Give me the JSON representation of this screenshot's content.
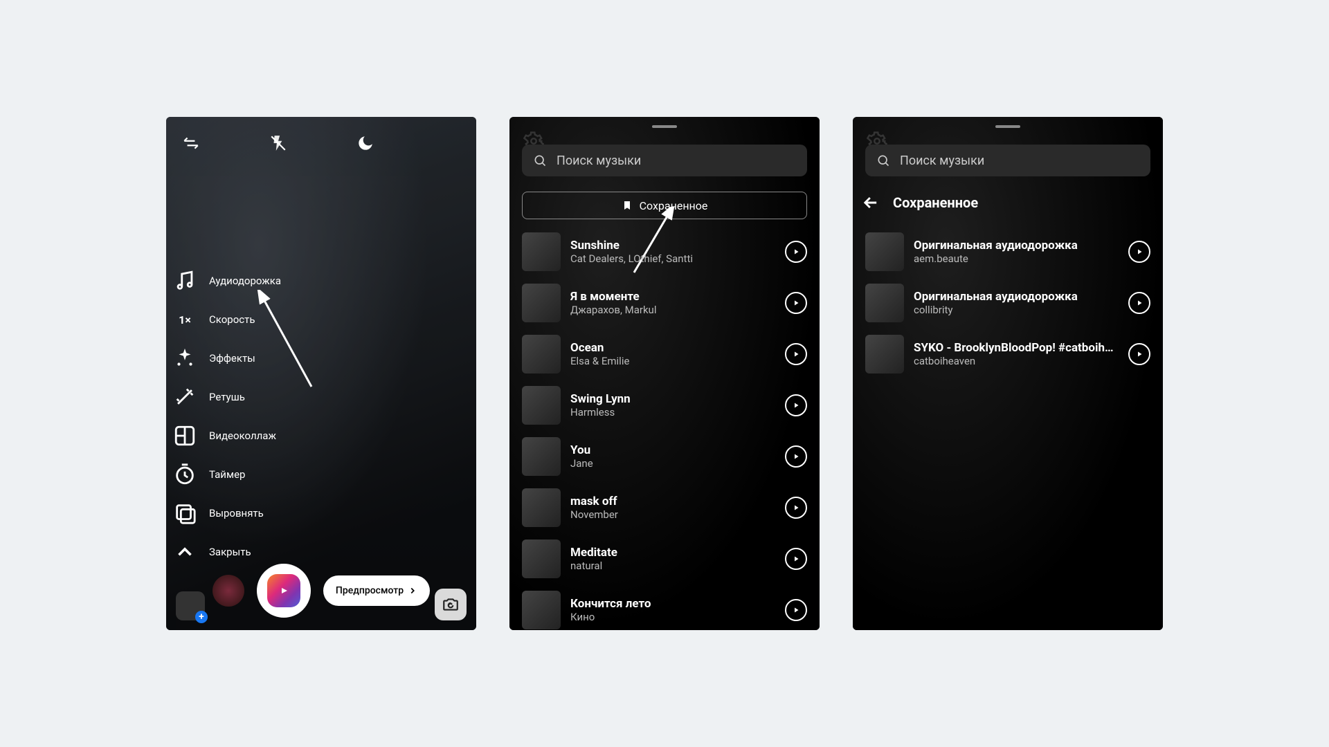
{
  "phone1": {
    "sidebar": [
      {
        "label": "Аудиодорожка",
        "icon": "music-icon"
      },
      {
        "label": "Скорость",
        "icon": "speed-1x"
      },
      {
        "label": "Эффекты",
        "icon": "sparkle-icon"
      },
      {
        "label": "Ретушь",
        "icon": "wand-icon"
      },
      {
        "label": "Видеоколлаж",
        "icon": "collage-icon"
      },
      {
        "label": "Таймер",
        "icon": "timer-icon"
      },
      {
        "label": "Выровнять",
        "icon": "align-icon"
      },
      {
        "label": "Закрыть",
        "icon": "chevron-up-icon"
      }
    ],
    "speed_text": "1×",
    "preview_label": "Предпросмотр"
  },
  "phone2": {
    "search_placeholder": "Поиск музыки",
    "saved_label": "Сохраненное",
    "tracks": [
      {
        "title": "Sunshine",
        "artist": "Cat Dealers, LOthief, Santti"
      },
      {
        "title": "Я в моменте",
        "artist": "Джарахов, Markul"
      },
      {
        "title": "Ocean",
        "artist": "Elsa & Emilie"
      },
      {
        "title": "Swing Lynn",
        "artist": "Harmless"
      },
      {
        "title": "You",
        "artist": "Jane"
      },
      {
        "title": "mask off",
        "artist": "November"
      },
      {
        "title": "Meditate",
        "artist": "natural"
      },
      {
        "title": "Кончится лето",
        "artist": "Кино"
      }
    ]
  },
  "phone3": {
    "search_placeholder": "Поиск музыки",
    "header": "Сохраненное",
    "tracks": [
      {
        "title": "Оригинальная аудиодорожка",
        "artist": "aem.beaute"
      },
      {
        "title": "Оригинальная аудиодорожка",
        "artist": "collibrity"
      },
      {
        "title": "SYKO - BrooklynBloodPop! #catboiheaven",
        "artist": "catboiheaven"
      }
    ]
  }
}
